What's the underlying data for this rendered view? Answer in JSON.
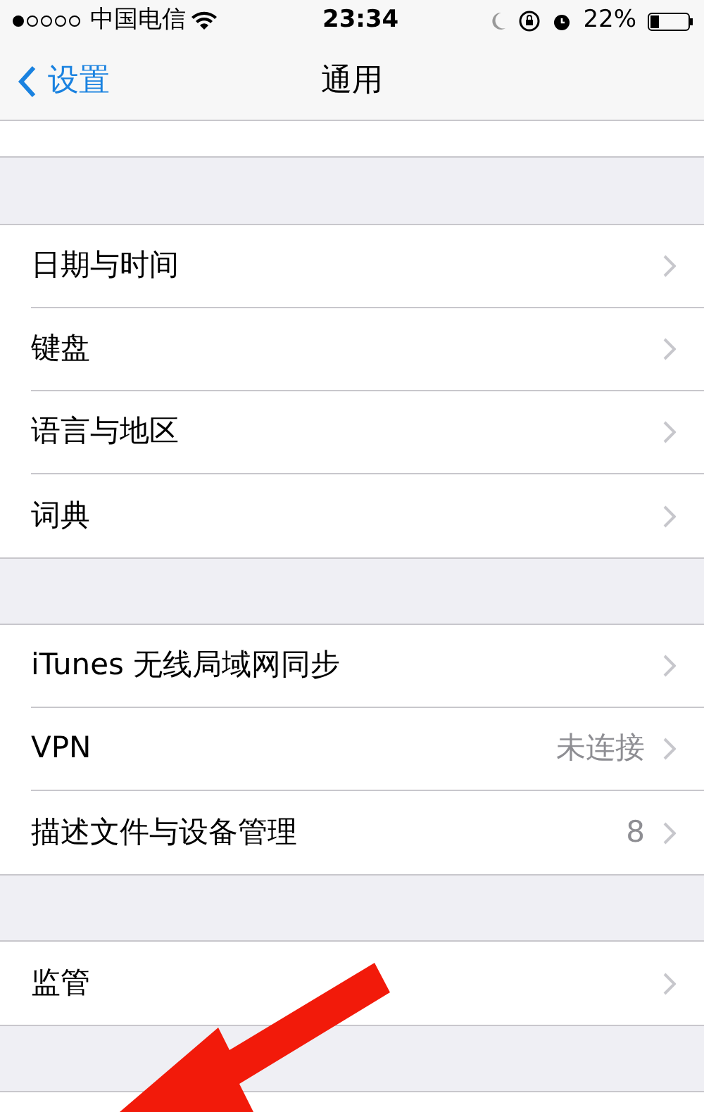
{
  "status_bar": {
    "carrier": "中国电信",
    "time": "23:34",
    "battery": "22%"
  },
  "nav_bar": {
    "back": "设置",
    "title": "通用"
  },
  "groups": [
    {
      "rows": [
        {
          "label": "日期与时间"
        },
        {
          "label": "键盘"
        },
        {
          "label": "语言与地区"
        },
        {
          "label": "词典"
        }
      ]
    },
    {
      "rows": [
        {
          "label": "iTunes 无线局域网同步"
        },
        {
          "label": "VPN",
          "value": "未连接"
        },
        {
          "label": "描述文件与设备管理",
          "value": "8"
        }
      ]
    },
    {
      "rows": [
        {
          "label": "监管"
        }
      ]
    }
  ]
}
